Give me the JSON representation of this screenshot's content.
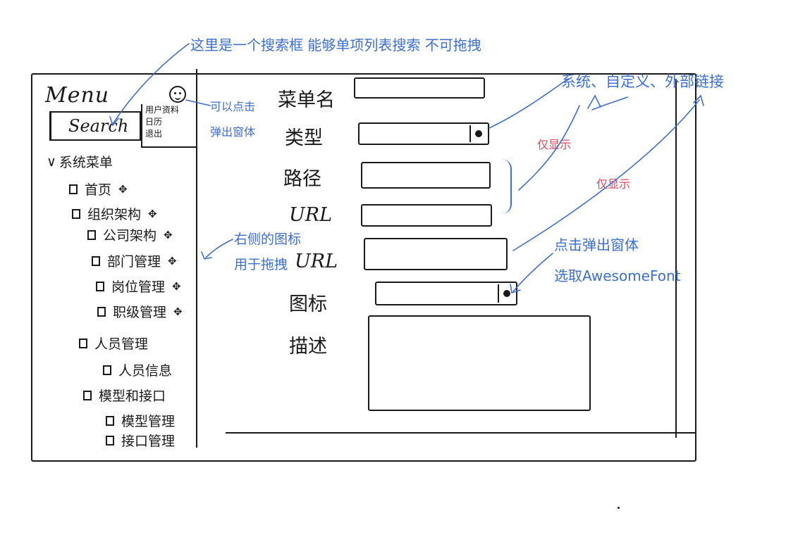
{
  "sidebar": {
    "title": "Menu",
    "search_label": "Search",
    "user_menu": [
      "用户资料",
      "日历",
      "退出"
    ],
    "section_label": "系统菜单",
    "tree": [
      {
        "label": "首页",
        "move": "✥"
      },
      {
        "label": "组织架构",
        "move": "✥"
      },
      {
        "label": "公司架构",
        "move": "✥"
      },
      {
        "label": "部门管理",
        "move": "✥"
      },
      {
        "label": "岗位管理",
        "move": "✥"
      },
      {
        "label": "职级管理",
        "move": "✥"
      },
      {
        "label": "人员管理",
        "move": ""
      },
      {
        "label": "人员信息",
        "move": ""
      },
      {
        "label": "模型和接口",
        "move": ""
      },
      {
        "label": "模型管理",
        "move": ""
      },
      {
        "label": "接口管理",
        "move": ""
      }
    ]
  },
  "form": {
    "labels": {
      "name": "菜单名",
      "type": "类型",
      "path": "路径",
      "url1": "URL",
      "url2": "URL",
      "icon": "图标",
      "desc": "描述"
    }
  },
  "notes": {
    "search_note": "这里是一个搜索框 能够单项列表搜索 不可拖拽",
    "popup_note": [
      "可以点击",
      "弹出窗体"
    ],
    "type_options": "系统、自定义、外部链接",
    "show_1": "仅显示",
    "show_2": "仅显示",
    "drag_note": [
      "右侧的图标",
      "用于拖拽"
    ],
    "icon_note": [
      "点击弹出窗体",
      "选取AwesomeFont"
    ]
  },
  "colors": {
    "ink": "#1a1a1a",
    "annotation_blue": "#3d6fcf",
    "annotation_red": "#e0475a"
  }
}
